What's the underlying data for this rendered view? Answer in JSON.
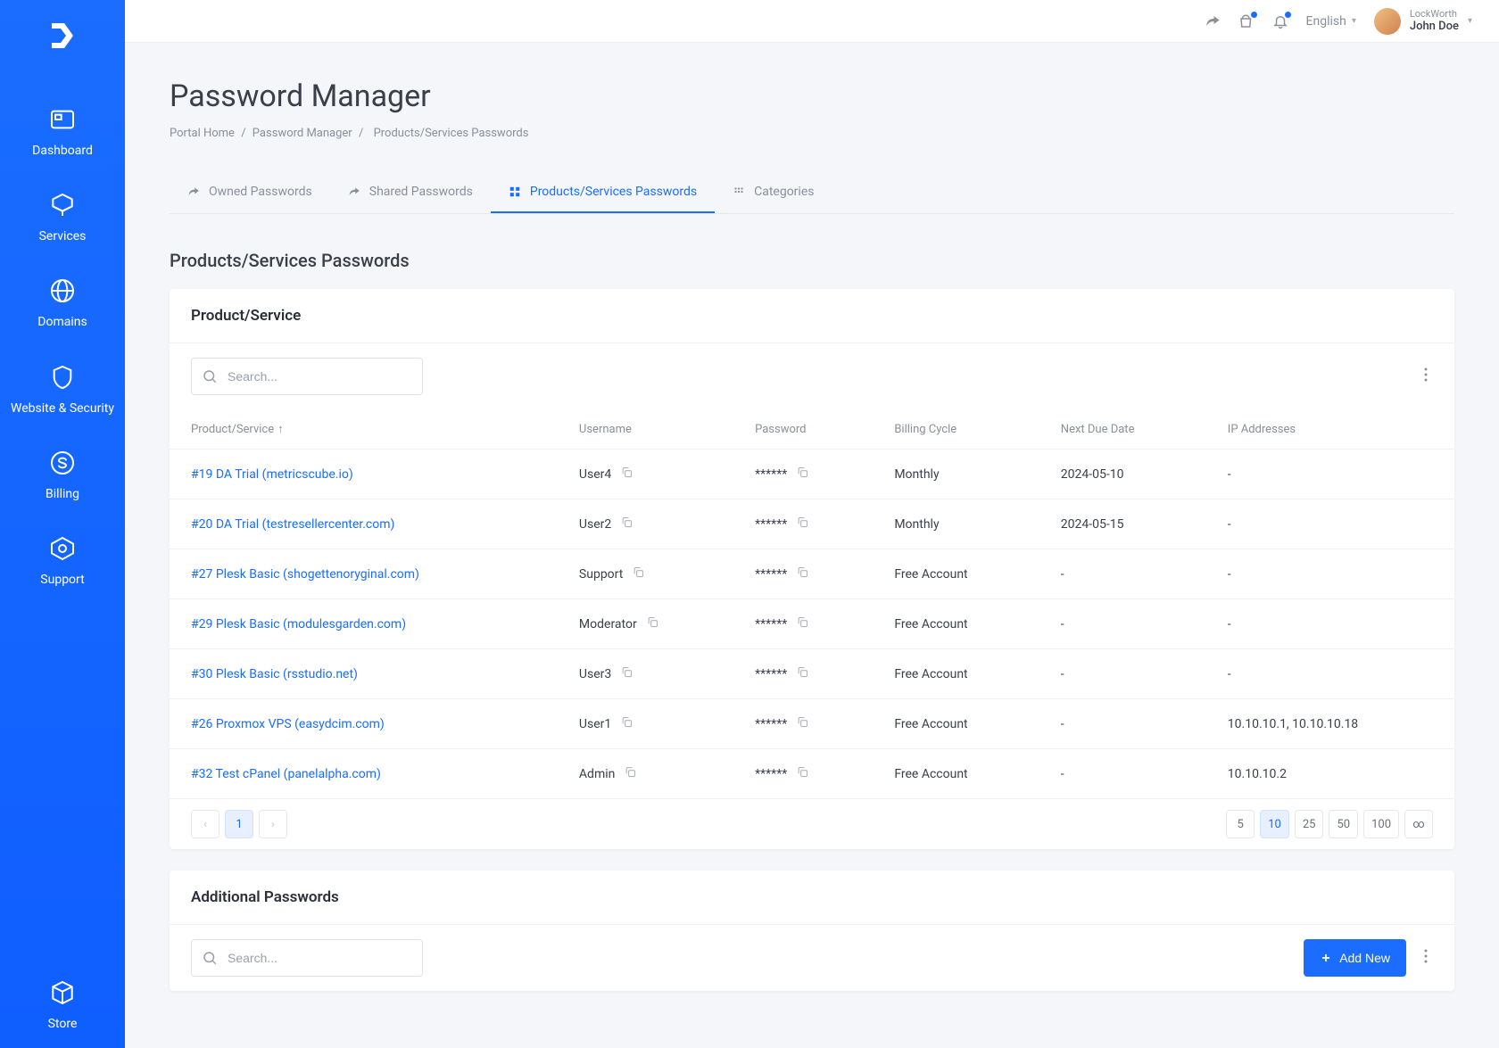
{
  "topbar": {
    "language": "English",
    "org": "LockWorth",
    "user": "John Doe"
  },
  "sidebar": {
    "items": [
      {
        "label": "Dashboard"
      },
      {
        "label": "Services"
      },
      {
        "label": "Domains"
      },
      {
        "label": "Website & Security"
      },
      {
        "label": "Billing"
      },
      {
        "label": "Support"
      }
    ],
    "bottom": {
      "label": "Store"
    }
  },
  "page": {
    "title": "Password Manager",
    "breadcrumb": {
      "home": "Portal Home",
      "parent": "Password Manager",
      "current": "Products/Services Passwords"
    }
  },
  "tabs": [
    {
      "label": "Owned Passwords"
    },
    {
      "label": "Shared Passwords"
    },
    {
      "label": "Products/Services Passwords"
    },
    {
      "label": "Categories"
    }
  ],
  "section": {
    "title": "Products/Services Passwords"
  },
  "mainCard": {
    "title": "Product/Service",
    "searchPlaceholder": "Search...",
    "columns": {
      "product": "Product/Service",
      "username": "Username",
      "password": "Password",
      "billing": "Billing Cycle",
      "nextDue": "Next Due Date",
      "ip": "IP Addresses"
    },
    "sortIndicator": "↑",
    "rows": [
      {
        "product": "#19 DA Trial (metricscube.io)",
        "username": "User4",
        "password": "******",
        "billing": "Monthly",
        "nextDue": "2024-05-10",
        "ip": "-"
      },
      {
        "product": "#20 DA Trial (testresellercenter.com)",
        "username": "User2",
        "password": "******",
        "billing": "Monthly",
        "nextDue": "2024-05-15",
        "ip": "-"
      },
      {
        "product": "#27 Plesk Basic (shogettenoryginal.com)",
        "username": "Support",
        "password": "******",
        "billing": "Free Account",
        "nextDue": "-",
        "ip": "-"
      },
      {
        "product": "#29 Plesk Basic (modulesgarden.com)",
        "username": "Moderator",
        "password": "******",
        "billing": "Free Account",
        "nextDue": "-",
        "ip": "-"
      },
      {
        "product": "#30 Plesk Basic (rsstudio.net)",
        "username": "User3",
        "password": "******",
        "billing": "Free Account",
        "nextDue": "-",
        "ip": "-"
      },
      {
        "product": "#26 Proxmox VPS (easydcim.com)",
        "username": "User1",
        "password": "******",
        "billing": "Free Account",
        "nextDue": "-",
        "ip": "10.10.10.1, 10.10.10.18"
      },
      {
        "product": "#32 Test cPanel (panelalpha.com)",
        "username": "Admin",
        "password": "******",
        "billing": "Free Account",
        "nextDue": "-",
        "ip": "10.10.10.2"
      }
    ],
    "pagination": {
      "current": "1",
      "pageSizes": [
        "5",
        "10",
        "25",
        "50",
        "100",
        "∞"
      ],
      "activeSize": "10"
    }
  },
  "additionalCard": {
    "title": "Additional Passwords",
    "searchPlaceholder": "Search...",
    "addButton": "Add New"
  }
}
